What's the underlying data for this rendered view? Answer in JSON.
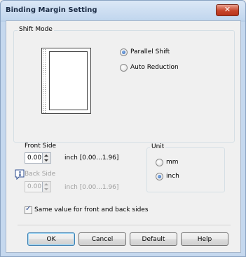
{
  "window": {
    "title": "Binding Margin Setting",
    "close_glyph": "✕"
  },
  "shift_mode": {
    "label": "Shift Mode",
    "options": [
      {
        "label": "Parallel Shift",
        "selected": true
      },
      {
        "label": "Auto Reduction",
        "selected": false
      }
    ]
  },
  "front_side": {
    "label": "Front Side",
    "value": "0.00",
    "range": "inch [0.00...1.96]"
  },
  "back_side": {
    "label": "Back Side",
    "value": "0.00",
    "range": "inch [0.00...1.96]",
    "enabled": false
  },
  "unit": {
    "label": "Unit",
    "options": [
      {
        "label": "mm",
        "selected": false
      },
      {
        "label": "inch",
        "selected": true
      }
    ]
  },
  "same_value": {
    "label": "Same value for front and back sides",
    "checked": true
  },
  "buttons": {
    "ok": "OK",
    "cancel": "Cancel",
    "default": "Default",
    "help": "Help"
  },
  "icons": {
    "info": "info-icon",
    "close": "close-icon",
    "page_preview": "page-preview-icon"
  },
  "colors": {
    "title_bar": "#c1d6ee",
    "close_button": "#c7452a",
    "radio_selected": "#1d5ab4"
  }
}
